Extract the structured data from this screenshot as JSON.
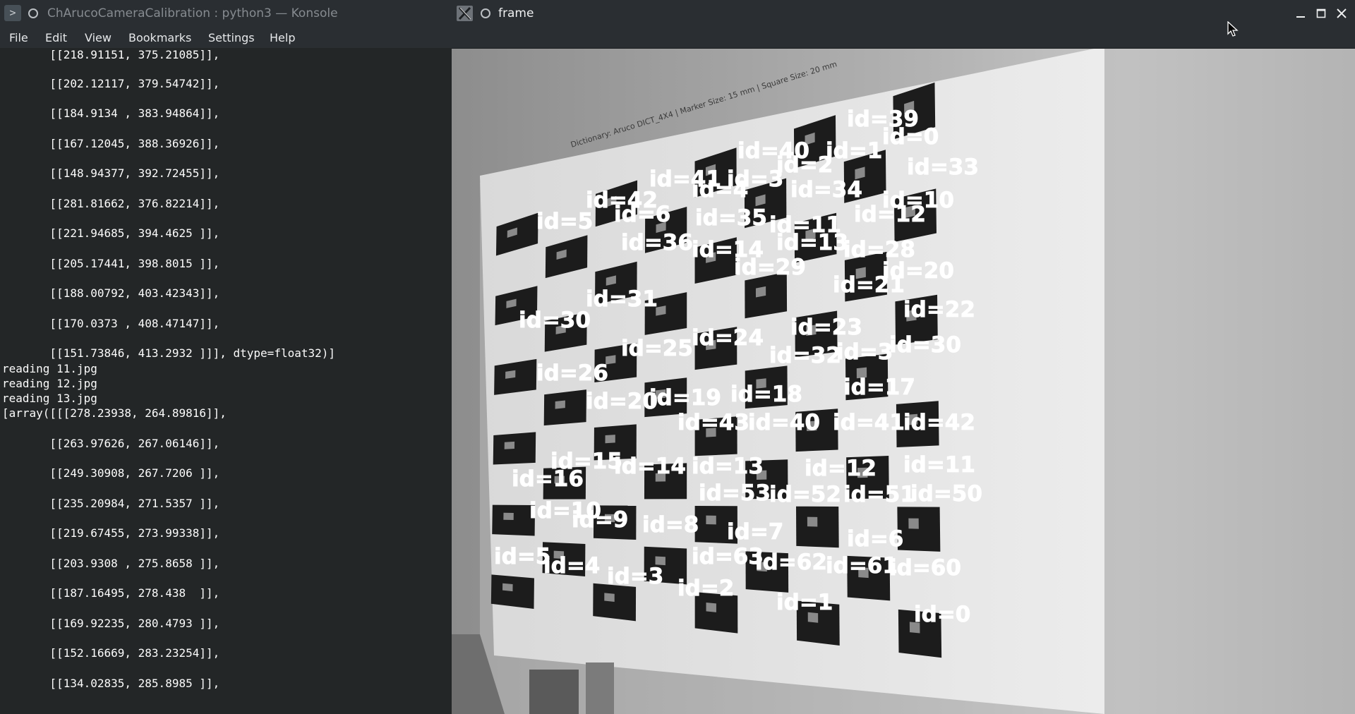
{
  "konsole": {
    "title": "ChArucoCameraCalibration : python3 — Konsole",
    "menu": [
      "File",
      "Edit",
      "View",
      "Bookmarks",
      "Settings",
      "Help"
    ],
    "terminal_lines": [
      "       [[218.91151, 375.21085]],",
      "",
      "       [[202.12117, 379.54742]],",
      "",
      "       [[184.9134 , 383.94864]],",
      "",
      "       [[167.12045, 388.36926]],",
      "",
      "       [[148.94377, 392.72455]],",
      "",
      "       [[281.81662, 376.82214]],",
      "",
      "       [[221.94685, 394.4625 ]],",
      "",
      "       [[205.17441, 398.8015 ]],",
      "",
      "       [[188.00792, 403.42343]],",
      "",
      "       [[170.0373 , 408.47147]],",
      "",
      "       [[151.73846, 413.2932 ]]], dtype=float32)]",
      "reading 11.jpg",
      "reading 12.jpg",
      "reading 13.jpg",
      "[array([[[278.23938, 264.89816]],",
      "",
      "       [[263.97626, 267.06146]],",
      "",
      "       [[249.30908, 267.7206 ]],",
      "",
      "       [[235.20984, 271.5357 ]],",
      "",
      "       [[219.67455, 273.99338]],",
      "",
      "       [[203.9308 , 275.8658 ]],",
      "",
      "       [[187.16495, 278.438  ]],",
      "",
      "       [[169.92235, 280.4793 ]],",
      "",
      "       [[152.16669, 283.23254]],",
      "",
      "       [[134.02835, 285.8985 ]],"
    ]
  },
  "frame": {
    "title": "frame",
    "board_caption": "Dictionary: Aruco DICT_4X4 | Marker Size: 15 mm | Square Size: 20 mm",
    "labels": [
      "id=39",
      "id=0",
      "id=40",
      "id=1",
      "id=2",
      "id=33",
      "id=41",
      "id=3",
      "id=4",
      "id=34",
      "id=10",
      "id=42",
      "id=5",
      "id=6",
      "id=35",
      "id=11",
      "id=12",
      "id=13",
      "id=28",
      "id=36",
      "id=14",
      "id=29",
      "id=20",
      "id=21",
      "id=22",
      "id=30",
      "id=31",
      "id=23",
      "id=24",
      "id=25",
      "id=26",
      "id=32",
      "id=3",
      "id=30",
      "id=17",
      "id=18",
      "id=19",
      "id=40",
      "id=41",
      "id=42",
      "id=43",
      "id=20",
      "id=12",
      "id=11",
      "id=13",
      "id=14",
      "id=15",
      "id=50",
      "id=51",
      "id=52",
      "id=53",
      "id=10",
      "id=9",
      "id=8",
      "id=7",
      "id=6",
      "id=60",
      "id=61",
      "id=62",
      "id=63",
      "id=5",
      "id=4",
      "id=3",
      "id=2",
      "id=1",
      "id=0",
      "id=16"
    ]
  },
  "colors": {
    "titlebar": "#2a2e32",
    "terminal_bg": "#232627",
    "terminal_text": "#fcfcfc",
    "menu_text": "#e6e8ea",
    "frame_title_text": "#eff0f1"
  }
}
